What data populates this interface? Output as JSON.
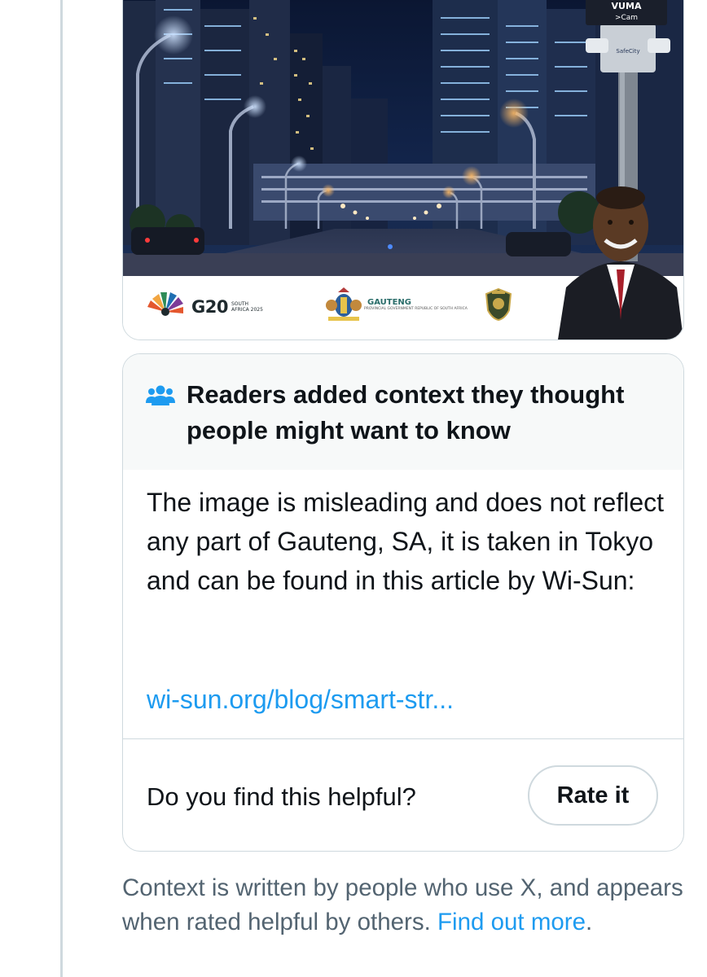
{
  "media": {
    "photo_alt_icon": "night-city-street-photo",
    "vuma_label": "VUMA",
    "cam_label": ">Cam",
    "safecity_label": "SafeCity",
    "g20": {
      "wordmark": "G20",
      "sub": "SOUTH AFRICA 2025"
    },
    "gauteng": {
      "wordmark": "GAUTENG",
      "sub": "PROVINCIAL GOVERNMENT REPUBLIC OF SOUTH AFRICA"
    }
  },
  "note": {
    "title": "Readers added context they thought people might want to know",
    "body": "The image is misleading and does not reflect any part of Gauteng, SA, it is taken in Tokyo and can be found in this article by Wi-Sun:",
    "link": "wi-sun.org/blog/smart-str...",
    "helpful_question": "Do you find this helpful?",
    "rate_button": "Rate it"
  },
  "footer": {
    "text": "Context is written by people who use X, and appears when rated helpful by others.",
    "link": "Find out more",
    "end": "."
  },
  "colors": {
    "accent": "#1d9bf0",
    "text": "#0f1419",
    "muted": "#536471",
    "border": "#cfd9de",
    "header_bg": "#f7f9f9"
  }
}
